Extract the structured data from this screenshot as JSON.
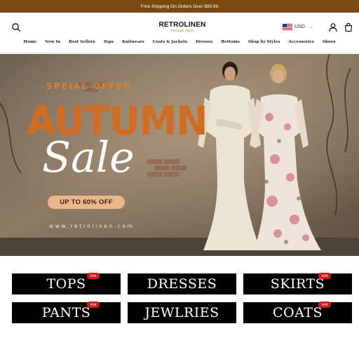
{
  "announcement": "Free Shipping On Orders Over $99.99",
  "logo": {
    "main": "RETROLINEN",
    "sub": "Vintage Style"
  },
  "currency": {
    "code": "USD",
    "flag": "us-flag-icon"
  },
  "icons": {
    "search": "search-icon",
    "account": "user-icon",
    "cart": "cart-icon",
    "dropdown": "chevron-down-icon"
  },
  "nav": [
    "Home",
    "New In",
    "Best Sellers",
    "Tops",
    "Knitwears",
    "Coats & Jackets",
    "Dresses",
    "Bottoms",
    "Shop by Styles",
    "Accessories",
    "Shoes"
  ],
  "hero": {
    "offer": "SPEIAL OFFER",
    "headline": "AUTUMN",
    "script": "Sale",
    "discount": "UP TO 60% OFF",
    "url": "www.retrolinen.com"
  },
  "categories": [
    {
      "label": "TOPS",
      "badge": "Hot"
    },
    {
      "label": "DRESSES",
      "badge": ""
    },
    {
      "label": "SKIRTS",
      "badge": "Hot"
    },
    {
      "label": "PANTS",
      "badge": "Hot"
    },
    {
      "label": "JEWLRIES",
      "badge": ""
    },
    {
      "label": "COATS",
      "badge": "Hot"
    }
  ],
  "colors": {
    "announcement_bg": "#7a4a10",
    "accent_orange": "#cf6d25",
    "badge_red": "#d3161d",
    "category_bg": "#000000"
  }
}
